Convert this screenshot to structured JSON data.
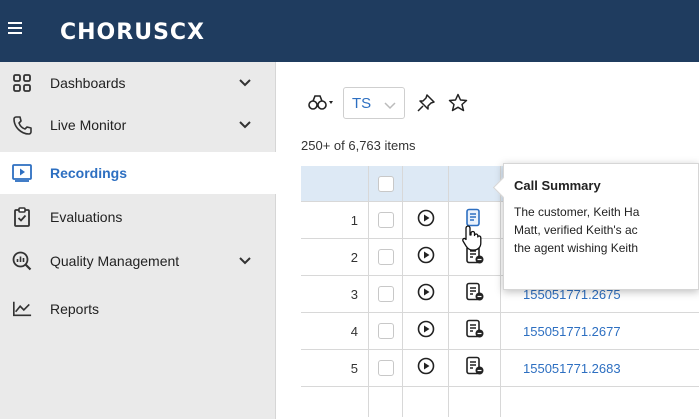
{
  "header": {
    "logo": "CHORUSCX"
  },
  "sidebar": {
    "items": [
      {
        "label": "Dashboards",
        "icon": "dashboard-grid-icon",
        "expandable": true
      },
      {
        "label": "Live Monitor",
        "icon": "phone-icon",
        "expandable": true
      },
      {
        "label": "Recordings",
        "icon": "play-video-icon",
        "expandable": false,
        "active": true
      },
      {
        "label": "Evaluations",
        "icon": "clipboard-check-icon",
        "expandable": false
      },
      {
        "label": "Quality Management",
        "icon": "search-chart-icon",
        "expandable": true
      },
      {
        "label": "Reports",
        "icon": "line-chart-icon",
        "expandable": false
      }
    ]
  },
  "toolbar": {
    "view_value": "TS"
  },
  "grid": {
    "count_text": "250+ of 6,763 items",
    "rows": [
      {
        "num": "1",
        "id": ""
      },
      {
        "num": "2",
        "id": ""
      },
      {
        "num": "3",
        "id": "155051771.2675"
      },
      {
        "num": "4",
        "id": "155051771.2677"
      },
      {
        "num": "5",
        "id": "155051771.2683"
      }
    ]
  },
  "tooltip": {
    "title": "Call Summary",
    "lines": [
      "The customer, Keith Ha",
      "Matt, verified Keith's ac",
      "the agent wishing Keith"
    ]
  },
  "colors": {
    "header_bg": "#1f3c5f",
    "accent": "#2d6fc1",
    "sidebar_bg": "#eaeaea",
    "grid_header_bg": "#dde9f5"
  }
}
